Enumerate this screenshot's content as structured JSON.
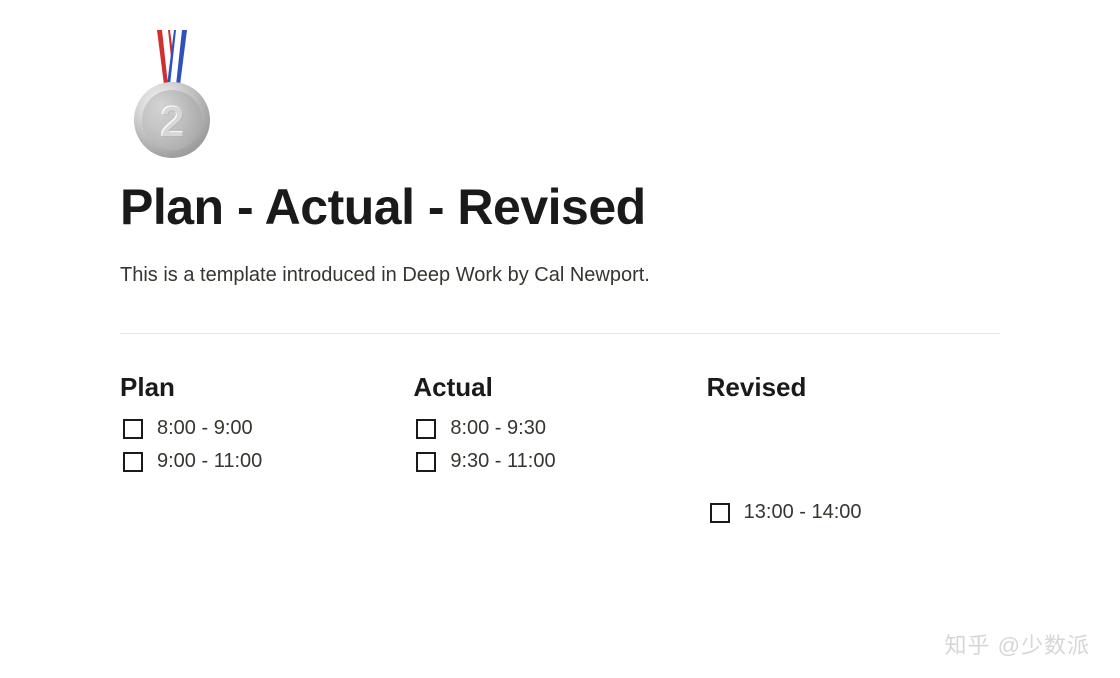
{
  "icon": "second-place-medal",
  "title": "Plan - Actual - Revised",
  "description": "This is a template introduced in Deep Work by Cal Newport.",
  "columns": {
    "plan": {
      "heading": "Plan",
      "items": [
        {
          "label": "8:00 - 9:00",
          "checked": false
        },
        {
          "label": "9:00 - 11:00",
          "checked": false
        }
      ]
    },
    "actual": {
      "heading": "Actual",
      "items": [
        {
          "label": "8:00 - 9:30",
          "checked": false
        },
        {
          "label": "9:30 - 11:00",
          "checked": false
        }
      ]
    },
    "revised": {
      "heading": "Revised",
      "items": [
        {
          "label": "13:00 - 14:00",
          "checked": false
        }
      ]
    }
  },
  "watermark": "知乎 @少数派"
}
